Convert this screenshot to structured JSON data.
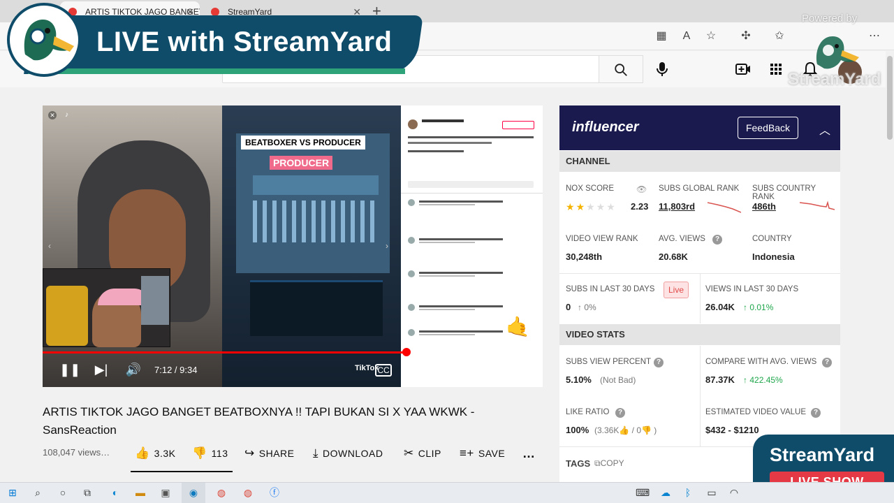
{
  "browser": {
    "tabs": [
      {
        "label": "ARTIS TIKTOK JAGO BANGET",
        "active": true
      },
      {
        "label": "StreamYard",
        "active": false
      }
    ],
    "new_tab": "+"
  },
  "youtube": {
    "search_placeholder": ""
  },
  "overlay": {
    "banner_title": "LIVE with StreamYard",
    "powered_by": "Powered by",
    "watermark": "StreamYard",
    "badge_title": "StreamYard",
    "badge_live": "LIVE SHOW"
  },
  "video": {
    "beatboxer_label": "BEATBOXER VS PRODUCER",
    "producer_label": "PRODUCER",
    "tiktok_handle": "TikTok",
    "timecode": "7:12 / 9:34",
    "progress": 0.727,
    "title": "ARTIS TIKTOK JAGO BANGET BEATBOXNYA !! TAPI BUKAN SI X YAA WKWK - SansReaction",
    "views": "108,047 views…",
    "actions": {
      "like": "3.3K",
      "dislike": "113",
      "share": "SHARE",
      "download": "DOWNLOAD",
      "clip": "CLIP",
      "save": "SAVE",
      "more": "…"
    }
  },
  "influencer": {
    "logo": "influencer",
    "feedback": "FeedBack",
    "channel_header": "CHANNEL",
    "nox_score_label": "NOX SCORE",
    "nox_score_value": "2.23",
    "nox_stars": 2,
    "subs_global_rank_label": "SUBS GLOBAL RANK",
    "subs_global_rank_value": "11,803rd",
    "subs_country_rank_label": "SUBS COUNTRY RANK",
    "subs_country_rank_value": "486th",
    "video_view_rank_label": "VIDEO VIEW RANK",
    "video_view_rank_value": "30,248th",
    "avg_views_label": "AVG. VIEWS",
    "avg_views_value": "20.68K",
    "country_label": "COUNTRY",
    "country_value": "Indonesia",
    "subs_30_label": "SUBS IN LAST 30 DAYS",
    "subs_30_value": "0",
    "subs_30_change": "0%",
    "live_badge": "Live",
    "views_30_label": "VIEWS IN LAST 30 DAYS",
    "views_30_value": "26.04K",
    "views_30_change": "0.01%",
    "video_stats_header": "VIDEO STATS",
    "subs_view_pct_label": "SUBS VIEW PERCENT",
    "subs_view_pct_value": "5.10%",
    "subs_view_pct_note": "(Not Bad)",
    "compare_avg_label": "COMPARE WITH AVG. VIEWS",
    "compare_avg_value": "87.37K",
    "compare_avg_change": "422.45%",
    "like_ratio_label": "LIKE RATIO",
    "like_ratio_value": "100%",
    "like_ratio_note": "(3.36K",
    "like_ratio_note2": "/ 0",
    "like_ratio_note3": ")",
    "est_value_label": "ESTIMATED VIDEO VALUE",
    "est_value_value": "$432 - $1210",
    "tags_label": "TAGS",
    "copy_label": "COPY"
  },
  "colors": {
    "banner": "#0f4c6a",
    "accent_green": "#2ea37a",
    "influencer_header": "#1a1a4e",
    "youtube_red": "#ff0000",
    "live_red": "#e63946"
  }
}
